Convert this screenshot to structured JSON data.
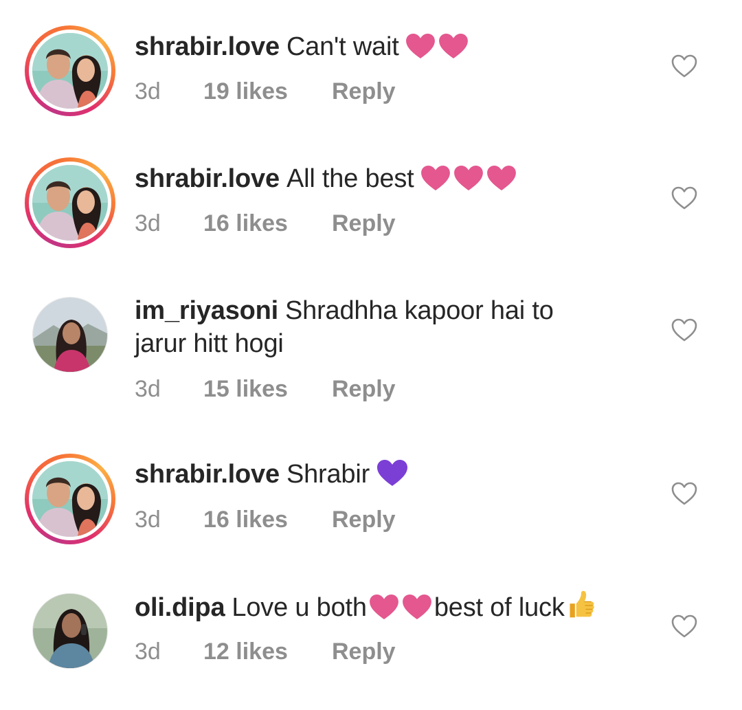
{
  "comments": [
    {
      "username": "shrabir.love",
      "text": "Can't wait",
      "emoji": [
        "heart",
        "heart"
      ],
      "time": "3d",
      "likes": "19 likes",
      "reply": "Reply",
      "story_ring": true
    },
    {
      "username": "shrabir.love",
      "text": "All the best",
      "emoji": [
        "heart",
        "heart",
        "heart"
      ],
      "time": "3d",
      "likes": "16 likes",
      "reply": "Reply",
      "story_ring": true
    },
    {
      "username": "im_riyasoni",
      "text": "Shradhha kapoor hai to jarur hitt hogi",
      "emoji": [],
      "time": "3d",
      "likes": "15 likes",
      "reply": "Reply",
      "story_ring": false
    },
    {
      "username": "shrabir.love",
      "text": "Shrabir",
      "emoji": [
        "purple-heart"
      ],
      "time": "3d",
      "likes": "16 likes",
      "reply": "Reply",
      "story_ring": true
    },
    {
      "username": "oli.dipa",
      "text": "Love u both",
      "text_after_emoji": "best of luck",
      "emoji": [
        "heart",
        "heart"
      ],
      "trailing_emoji": "thumbs-up",
      "time": "3d",
      "likes": "12 likes",
      "reply": "Reply",
      "story_ring": false
    }
  ],
  "colors": {
    "heart_pink": "#e4578f",
    "heart_purple": "#7b3fd6",
    "meta_gray": "#8e8e8e",
    "text_dark": "#262626",
    "like_outline": "#8e8e8e"
  }
}
